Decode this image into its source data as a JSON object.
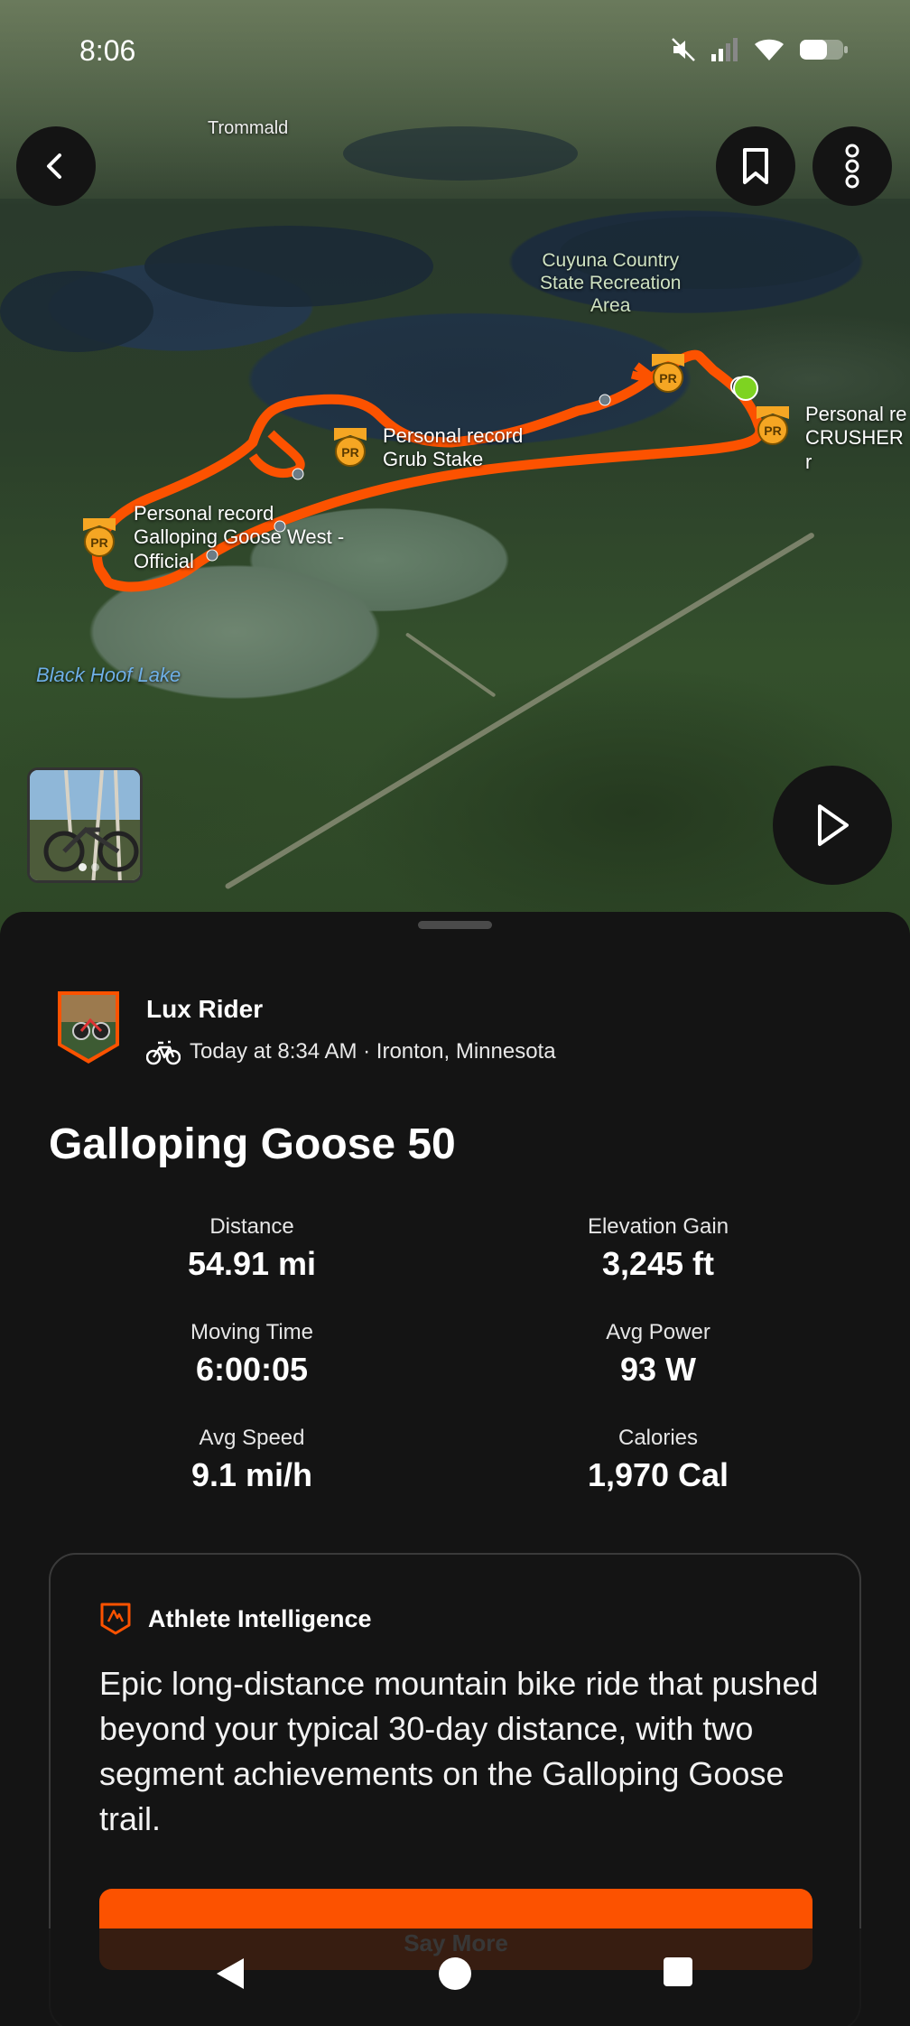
{
  "status_bar": {
    "time": "8:06",
    "icons": [
      "mute-icon",
      "signal-icon",
      "wifi-icon",
      "battery-icon"
    ]
  },
  "map": {
    "labels": {
      "town": "Trommald",
      "park": "Cuyuna Country\nState Recreation\nArea",
      "lake": "Black Hoof Lake",
      "pr1": "Personal record\nGalloping Goose West -\nOfficial",
      "pr2": "Personal record\nGrub Stake",
      "pr3": "Personal re\nCRUSHER r"
    },
    "route_color": "#fc5200",
    "pr_badge_text": "PR",
    "media_count": 2
  },
  "activity": {
    "athlete_name": "Lux Rider",
    "meta": "Today at 8:34 AM · Ironton, Minnesota",
    "activity_type_icon": "bike-icon",
    "title": "Galloping Goose 50",
    "stats": [
      {
        "label": "Distance",
        "value": "54.91 mi"
      },
      {
        "label": "Elevation Gain",
        "value": "3,245 ft"
      },
      {
        "label": "Moving Time",
        "value": "6:00:05"
      },
      {
        "label": "Avg Power",
        "value": "93 W"
      },
      {
        "label": "Avg Speed",
        "value": "9.1 mi/h"
      },
      {
        "label": "Calories",
        "value": "1,970 Cal"
      }
    ]
  },
  "athlete_intelligence": {
    "title": "Athlete Intelligence",
    "text": "Epic long-distance mountain bike ride that pushed beyond your typical 30-day distance, with two segment achievements on the Galloping Goose trail.",
    "button": "Say More"
  },
  "colors": {
    "accent": "#fc5200",
    "background": "#141414",
    "start_marker": "#7ed321"
  }
}
